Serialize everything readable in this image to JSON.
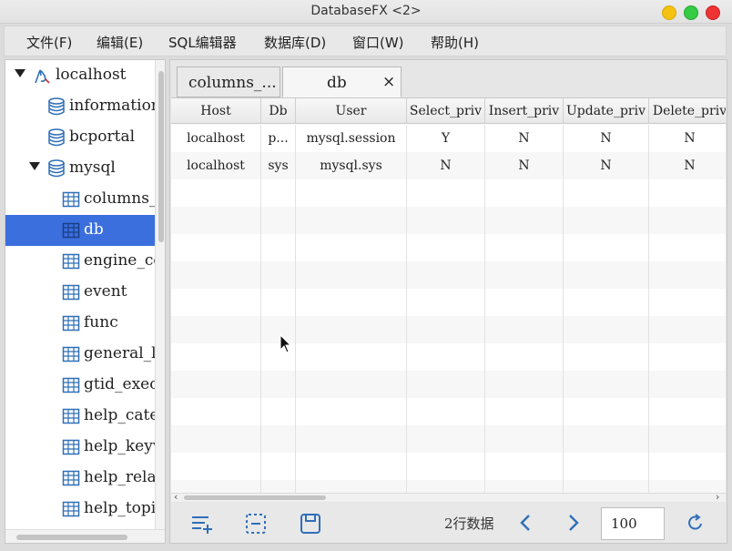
{
  "window": {
    "title": "DatabaseFX <2>"
  },
  "menu": [
    "文件(F)",
    "编辑(E)",
    "SQL编辑器",
    "数据库(D)",
    "窗口(W)",
    "帮助(H)"
  ],
  "tree": {
    "items": [
      {
        "label": "localhost",
        "icon": "server-icon"
      },
      {
        "label": "information_schema",
        "icon": "database-icon"
      },
      {
        "label": "bcportal",
        "icon": "database-icon"
      },
      {
        "label": "mysql",
        "icon": "database-icon"
      },
      {
        "label": "columns_priv",
        "icon": "table-icon"
      },
      {
        "label": "db",
        "icon": "table-icon"
      },
      {
        "label": "engine_cost",
        "icon": "table-icon"
      },
      {
        "label": "event",
        "icon": "table-icon"
      },
      {
        "label": "func",
        "icon": "table-icon"
      },
      {
        "label": "general_log",
        "icon": "table-icon"
      },
      {
        "label": "gtid_executed",
        "icon": "table-icon"
      },
      {
        "label": "help_category",
        "icon": "table-icon"
      },
      {
        "label": "help_keyword",
        "icon": "table-icon"
      },
      {
        "label": "help_relation",
        "icon": "table-icon"
      },
      {
        "label": "help_topic",
        "icon": "table-icon"
      }
    ]
  },
  "tabs": [
    {
      "label": "columns_..."
    },
    {
      "label": "db",
      "close": "×"
    }
  ],
  "grid": {
    "columns": [
      "Host",
      "Db",
      "User",
      "Select_priv",
      "Insert_priv",
      "Update_priv",
      "Delete_priv"
    ],
    "rows": [
      [
        "localhost",
        "p...",
        "mysql.session",
        "Y",
        "N",
        "N",
        "N"
      ],
      [
        "localhost",
        "sys",
        "mysql.sys",
        "N",
        "N",
        "N",
        "N"
      ]
    ]
  },
  "footer": {
    "row_count": "2行数据",
    "page_size": "100"
  },
  "colors": {
    "selection": "#3b6fde",
    "icon_blue": "#2f6fb8"
  }
}
